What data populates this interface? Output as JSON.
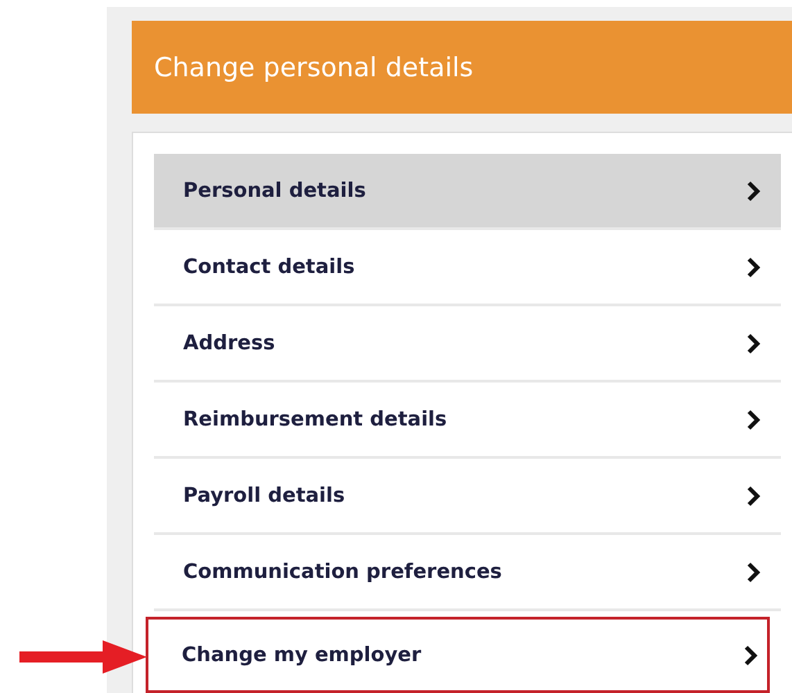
{
  "header": {
    "title": "Change personal details"
  },
  "menu": [
    {
      "label": "Personal details",
      "selected": true,
      "highlighted": false
    },
    {
      "label": "Contact details",
      "selected": false,
      "highlighted": false
    },
    {
      "label": "Address",
      "selected": false,
      "highlighted": false
    },
    {
      "label": "Reimbursement details",
      "selected": false,
      "highlighted": false
    },
    {
      "label": "Payroll details",
      "selected": false,
      "highlighted": false
    },
    {
      "label": "Communication preferences",
      "selected": false,
      "highlighted": false
    },
    {
      "label": "Change my employer",
      "selected": false,
      "highlighted": true
    }
  ]
}
